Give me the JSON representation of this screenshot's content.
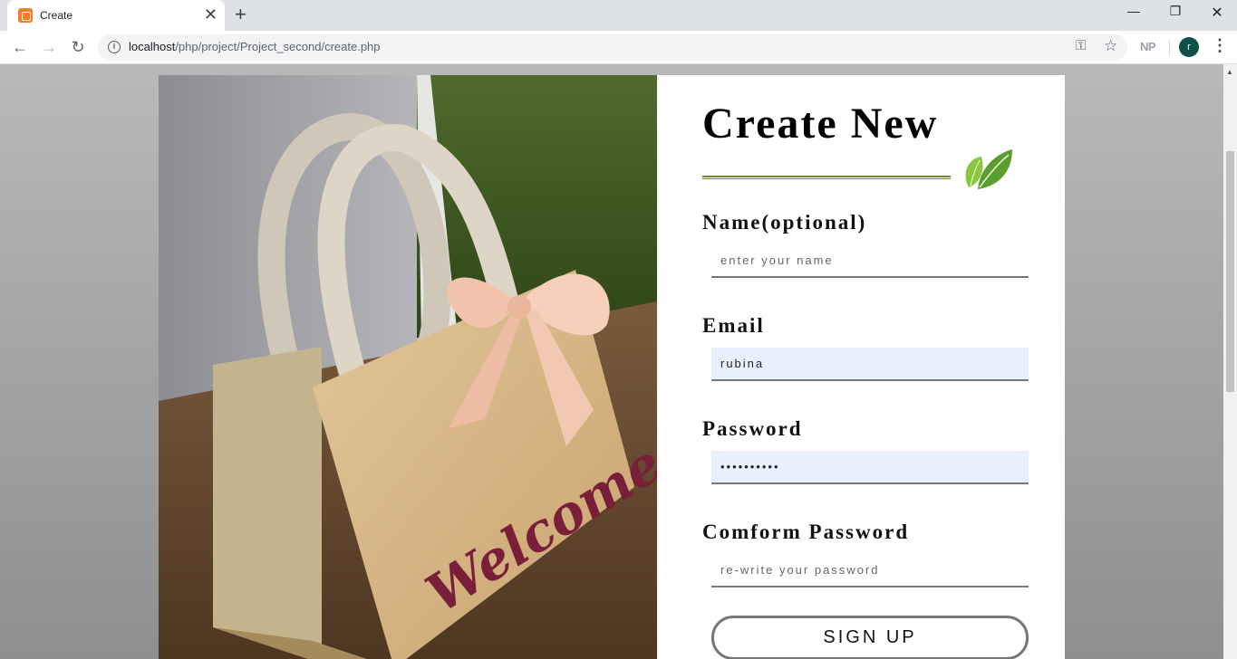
{
  "browser": {
    "tab_title": "Create",
    "new_tab_symbol": "+",
    "url_host": "localhost",
    "url_path": "/php/project/Project_second/create.php",
    "extension_label": "NP",
    "profile_initial": "r",
    "profile_color": "#0b5345"
  },
  "form": {
    "title": "Create New",
    "accent_color": "#6b8e23",
    "name": {
      "label": "Name(optional)",
      "placeholder": "enter your name",
      "value": ""
    },
    "email": {
      "label": "Email",
      "value": "rubina"
    },
    "password": {
      "label": "Password",
      "value": "••••••••••"
    },
    "confirm": {
      "label": "Comform Password",
      "placeholder": "re-write your password",
      "value": ""
    },
    "submit_label": "SIGN UP"
  },
  "photo": {
    "bag_text": "Welcome"
  },
  "icons": {
    "favicon": "xampp-icon",
    "leaf": "leaf-icon"
  }
}
